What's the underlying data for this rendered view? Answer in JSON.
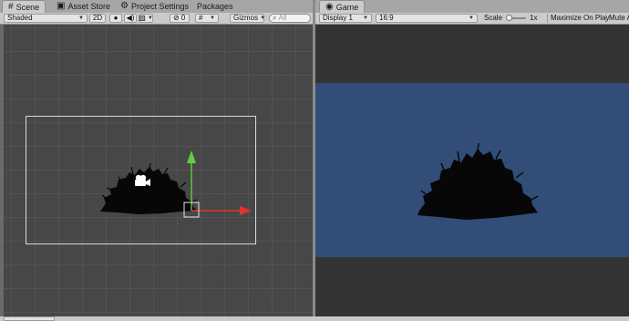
{
  "scene_tabs": [
    {
      "label": "Scene",
      "icon": "grid-icon"
    },
    {
      "label": "Asset Store",
      "icon": "store-icon"
    },
    {
      "label": "Project Settings",
      "icon": "gear-icon"
    },
    {
      "label": "Packages",
      "icon": ""
    }
  ],
  "game_tab": {
    "label": "Game",
    "icon": "game-controller-icon"
  },
  "scene_toolbar": {
    "draw_mode": "Shaded",
    "mode_2d": "2D",
    "hidden_objects_count": "0",
    "gizmos": "Gizmos",
    "search_placeholder": "All"
  },
  "game_toolbar": {
    "display": "Display 1",
    "aspect": "16:9",
    "scale_label": "Scale",
    "scale_value": "1x",
    "scale_level": 0.0,
    "maximize": "Maximize On Play",
    "mute": "Mute A"
  },
  "colors": {
    "scene_bg": "#474747",
    "game_sky": "#314d78",
    "game_bg": "#333333",
    "gizmo_x": "#e0352b",
    "gizmo_y": "#5fcf3c"
  }
}
